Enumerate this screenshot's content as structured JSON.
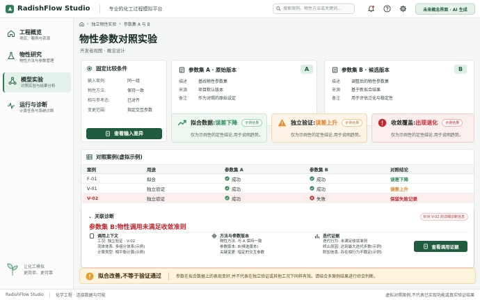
{
  "app": {
    "name": "RadishFlow Studio",
    "subtitle": "专业的化工过程模拟平台",
    "ai_badge": "未来概念界面 · AI 生成"
  },
  "search": {
    "placeholder": "搜索案例、物性方法或关键词..."
  },
  "sidebar": {
    "items": [
      {
        "title": "工程概览",
        "desc": "项目、案例与资源",
        "icon": "home-icon"
      },
      {
        "title": "物性研究",
        "desc": "物性方法与参数管理",
        "icon": "flask-icon"
      },
      {
        "title": "模型实验",
        "desc": "对照实验与结果分析",
        "icon": "network-icon"
      },
      {
        "title": "运行与诊断",
        "desc": "计算任务与系统诊断",
        "icon": "pulse-icon"
      }
    ],
    "footer": {
      "line1": "让化工模拟",
      "line2": "更简单、更可靠"
    }
  },
  "breadcrumb": [
    "独立物性实验",
    "参数集 A 与 B"
  ],
  "page": {
    "title": "物性参数对照实验",
    "subtitle": "开发者视图 · 概念设计"
  },
  "fixed": {
    "title": "固定比较条件",
    "rows": [
      {
        "k": "输入案例:",
        "v": "同一组"
      },
      {
        "k": "物性方法:",
        "v": "保持一致"
      },
      {
        "k": "相与参考态:",
        "v": "已对齐"
      },
      {
        "k": "变更范围:",
        "v": "指定交互参数"
      }
    ],
    "button": "查看输入差异"
  },
  "set_a": {
    "title": "参数集 A · 原始版本",
    "letter": "A",
    "rows": [
      {
        "k": "描述",
        "v": "基线物性参数集"
      },
      {
        "k": "来源",
        "v": "项目默认版本"
      },
      {
        "k": "备注",
        "v": "作为对照的原始设定"
      }
    ]
  },
  "set_b": {
    "title": "参数集 B · 候选版本",
    "letter": "B",
    "rows": [
      {
        "k": "描述",
        "v": "调整后的物性参数集"
      },
      {
        "k": "来源",
        "v": "基于新拟合结果"
      },
      {
        "k": "备注",
        "v": "用于评估泛化与稳定性"
      }
    ]
  },
  "results": [
    {
      "label": "拟合数据:",
      "value": "误差下降",
      "pill": "示例结果",
      "desc": "仅为示例性的定性结论,用于说明趋势。",
      "color": "#2e8b57"
    },
    {
      "label": "独立验证:",
      "value": "误差上升",
      "pill": "示例结果",
      "desc": "仅为示例性的定性结论,用于说明趋势。",
      "color": "#d9822b"
    },
    {
      "label": "收敛覆盖:",
      "value": "出现退化",
      "pill": "示例结果",
      "desc": "仅为示例性的定性结论,用于说明趋势。",
      "color": "#c0282d"
    }
  ],
  "table": {
    "title": "对照案例(虚拟示例)",
    "headers": [
      "案例",
      "用途",
      "参数集 A",
      "参数集 B",
      "对照结论"
    ],
    "rows": [
      {
        "case": "F-01",
        "use": "拟合",
        "a": "成功",
        "b": "成功",
        "result": "误差下降"
      },
      {
        "case": "V-01",
        "use": "独立验证",
        "a": "成功",
        "b": "成功",
        "result": "误差上升"
      },
      {
        "case": "V-02",
        "use": "独立验证",
        "a": "成功",
        "b": "失败",
        "result": "保留失败记录"
      }
    ]
  },
  "diagnosis": {
    "label": "关联诊断",
    "title": "参数集 B:物性调用未满足收敛准则",
    "tag": "针对 V-02 的详细诊断信息",
    "col1": {
      "title": "调用上下文",
      "lines": [
        "工况: 独立验证 · V-02",
        "流体体系: 多组分体系(示例)",
        "计算类型: 相平衡计算(示例)"
      ]
    },
    "col2": {
      "title": "方法与参数版本",
      "lines": [
        "物性方法: 与 A 保持一致",
        "参数版本: B(候选版本)",
        "关键变更: 指定的交互参数"
      ]
    },
    "col3": {
      "title": "迭代证据",
      "lines": [
        "迭代行为: 未满足收敛准则",
        "终止原因: 达到最大迭代步数(示例)",
        "附加信息: 存在相行为不稳定(示例)"
      ]
    },
    "button": "查看调用证据"
  },
  "warning": {
    "title": "拟合改善,不等于验证通过",
    "desc": "参数在拟合数据上的表现变好,并不代表在独立验证或其他工况下同样有效。请结合多案例结果进行综合判断。"
  },
  "footer": {
    "left": "RadishFlow Studio",
    "middle": "化学工程 · 连接数据与可能",
    "right": "虚拟对照案例,不代表已实现功能或真实验证结果"
  },
  "colors": {
    "brand": "#215c3e",
    "success": "#2e8b57",
    "warning": "#d9822b",
    "danger": "#c0282d"
  }
}
